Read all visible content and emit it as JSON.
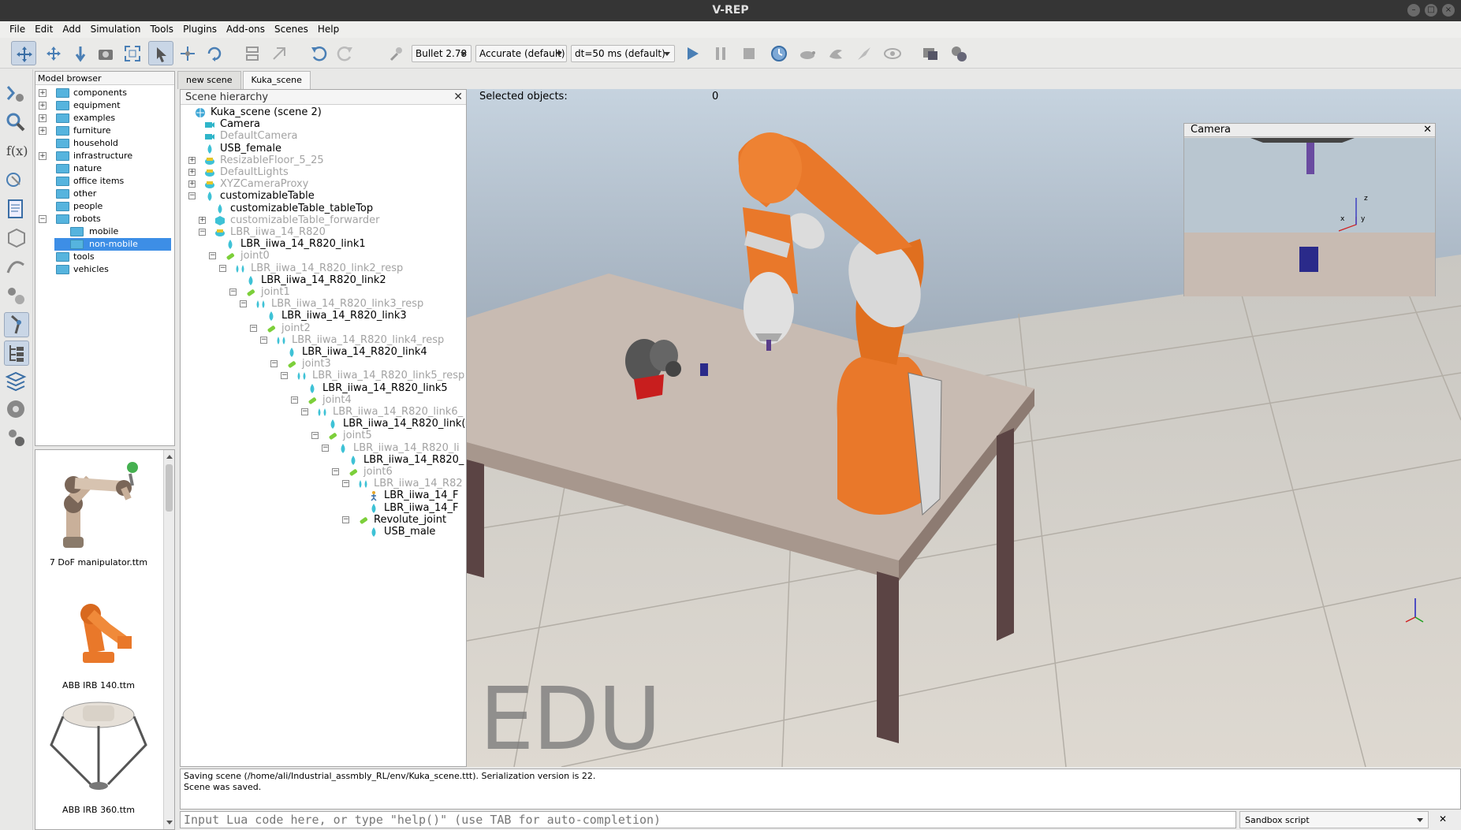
{
  "window": {
    "title": "V-REP"
  },
  "menu": [
    "File",
    "Edit",
    "Add",
    "Simulation",
    "Tools",
    "Plugins",
    "Add-ons",
    "Scenes",
    "Help"
  ],
  "toolbar": {
    "engine": "Bullet 2.78",
    "accuracy": "Accurate (default)",
    "timestep": "dt=50 ms (default)"
  },
  "model_browser": {
    "title": "Model browser",
    "items": [
      {
        "label": "components"
      },
      {
        "label": "equipment"
      },
      {
        "label": "examples"
      },
      {
        "label": "furniture"
      },
      {
        "label": "household"
      },
      {
        "label": "infrastructure"
      },
      {
        "label": "nature"
      },
      {
        "label": "office items"
      },
      {
        "label": "other"
      },
      {
        "label": "people"
      },
      {
        "label": "robots"
      },
      {
        "label": "mobile"
      },
      {
        "label": "non-mobile"
      },
      {
        "label": "tools"
      },
      {
        "label": "vehicles"
      }
    ],
    "thumbnails": [
      {
        "label": "7 DoF manipulator.ttm"
      },
      {
        "label": "ABB IRB 140.ttm"
      },
      {
        "label": "ABB IRB 360.ttm"
      }
    ]
  },
  "tabs": [
    "new scene",
    "Kuka_scene"
  ],
  "hierarchy": {
    "title": "Scene hierarchy",
    "rows": [
      {
        "label": "Kuka_scene (scene 2)"
      },
      {
        "label": "Camera"
      },
      {
        "label": "DefaultCamera"
      },
      {
        "label": "USB_female"
      },
      {
        "label": "ResizableFloor_5_25"
      },
      {
        "label": "DefaultLights"
      },
      {
        "label": "XYZCameraProxy"
      },
      {
        "label": "customizableTable"
      },
      {
        "label": "customizableTable_tableTop"
      },
      {
        "label": "customizableTable_forwarder"
      },
      {
        "label": "LBR_iiwa_14_R820"
      },
      {
        "label": "LBR_iiwa_14_R820_link1"
      },
      {
        "label": "joint0"
      },
      {
        "label": "LBR_iiwa_14_R820_link2_resp"
      },
      {
        "label": "LBR_iiwa_14_R820_link2"
      },
      {
        "label": "joint1"
      },
      {
        "label": "LBR_iiwa_14_R820_link3_resp"
      },
      {
        "label": "LBR_iiwa_14_R820_link3"
      },
      {
        "label": "joint2"
      },
      {
        "label": "LBR_iiwa_14_R820_link4_resp"
      },
      {
        "label": "LBR_iiwa_14_R820_link4"
      },
      {
        "label": "joint3"
      },
      {
        "label": "LBR_iiwa_14_R820_link5_resp"
      },
      {
        "label": "LBR_iiwa_14_R820_link5"
      },
      {
        "label": "joint4"
      },
      {
        "label": "LBR_iiwa_14_R820_link6_"
      },
      {
        "label": "LBR_iiwa_14_R820_link("
      },
      {
        "label": "joint5"
      },
      {
        "label": "LBR_iiwa_14_R820_li"
      },
      {
        "label": "LBR_iiwa_14_R820_"
      },
      {
        "label": "joint6"
      },
      {
        "label": "LBR_iiwa_14_R82"
      },
      {
        "label": "LBR_iiwa_14_F"
      },
      {
        "label": "LBR_iiwa_14_F"
      },
      {
        "label": "Revolute_joint"
      },
      {
        "label": "USB_male"
      }
    ]
  },
  "viewport": {
    "selected_label": "Selected objects:",
    "selected_count": "0",
    "watermark": "EDU",
    "camera_window_title": "Camera",
    "axis_z": "z",
    "axis_x": "x",
    "axis_y": "y"
  },
  "console": {
    "lines": [
      "Saving scene (/home/ali/Industrial_assmbly_RL/env/Kuka_scene.ttt). Serialization version is 22.",
      "Scene was saved."
    ]
  },
  "lua": {
    "placeholder": "Input Lua code here, or type \"help()\" (use TAB for auto-completion)",
    "script": "Sandbox script"
  },
  "colors": {
    "robot_orange": "#e9782a",
    "robot_white": "#d6d6d6",
    "table_top": "#c8bbb2",
    "table_leg": "#5b4444",
    "sky_top": "#c6d3df",
    "folder_blue": "#56b4de",
    "selection_blue": "#3d8ee6"
  }
}
